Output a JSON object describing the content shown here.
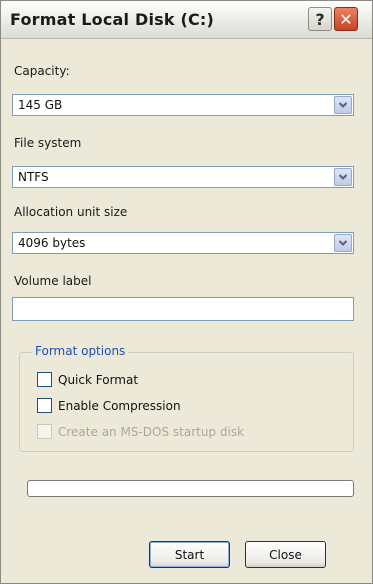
{
  "window": {
    "title": "Format Local Disk (C:)"
  },
  "title_buttons": {
    "help": "?",
    "close": "✕"
  },
  "capacity": {
    "label": "Capacity:",
    "value": "145 GB"
  },
  "file_system": {
    "label": "File system",
    "value": "NTFS"
  },
  "allocation_unit_size": {
    "label": "Allocation unit size",
    "value": "4096 bytes"
  },
  "volume_label": {
    "label": "Volume label",
    "value": ""
  },
  "format_options": {
    "title": "Format options",
    "quick_format": {
      "label": "Quick Format",
      "checked": false,
      "enabled": true
    },
    "enable_compression": {
      "label": "Enable Compression",
      "checked": false,
      "enabled": true
    },
    "msdos_startup_disk": {
      "label": "Create an MS-DOS startup disk",
      "checked": false,
      "enabled": false
    }
  },
  "progress": {
    "value": 0
  },
  "buttons": {
    "start": "Start",
    "close": "Close"
  },
  "colors": {
    "window_bg": "#ece9d8",
    "group_title": "#1e4fb5",
    "close_button": "#c74226",
    "input_border": "#7f9db9"
  },
  "icons": {
    "dropdown": "chevron-down-icon",
    "help": "question-mark-icon",
    "close": "close-x-icon"
  }
}
